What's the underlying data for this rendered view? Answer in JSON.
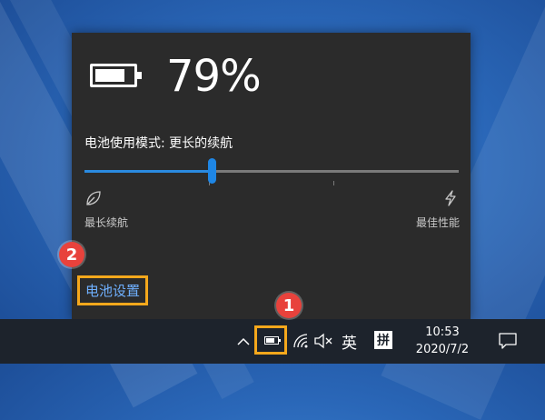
{
  "flyout": {
    "battery_percent": "79%",
    "battery_level": 0.79,
    "power_mode_label": "电池使用模式: 更长的续航",
    "slider_position": 0.34,
    "left_end_label": "最长续航",
    "right_end_label": "最佳性能",
    "settings_link": "电池设置"
  },
  "callouts": [
    "1",
    "2"
  ],
  "taskbar": {
    "language": "英",
    "ime": "拼",
    "time": "10:53",
    "date": "2020/7/2"
  },
  "colors": {
    "accent": "#1e86e5",
    "highlight_border": "#f5a81c",
    "callout": "#e8423c",
    "flyout_bg": "#2b2b2b",
    "taskbar_bg": "#1d232c"
  },
  "icons": [
    "battery-icon",
    "leaf-icon",
    "lightning-icon",
    "chevron-up-icon",
    "wifi-icon",
    "volume-muted-icon",
    "notification-icon"
  ]
}
